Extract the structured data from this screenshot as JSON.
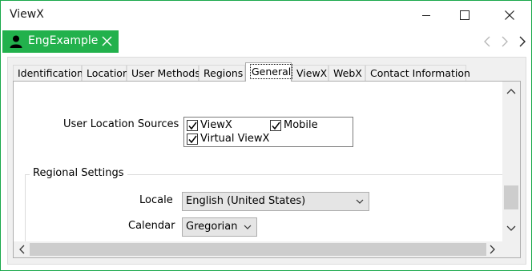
{
  "window": {
    "title": "ViewX"
  },
  "doc_tab": {
    "label": "EngExample"
  },
  "tabs": [
    {
      "label": "Identification"
    },
    {
      "label": "Location"
    },
    {
      "label": "User Methods"
    },
    {
      "label": "Regions"
    },
    {
      "label": "General",
      "active": true
    },
    {
      "label": "ViewX"
    },
    {
      "label": "WebX"
    },
    {
      "label": "Contact Information"
    }
  ],
  "general": {
    "user_location_sources_label": "User Location Sources",
    "sources": [
      {
        "label": "ViewX",
        "checked": true
      },
      {
        "label": "Mobile",
        "checked": true
      },
      {
        "label": "Virtual ViewX",
        "checked": true
      }
    ],
    "regional_settings_title": "Regional Settings",
    "locale_label": "Locale",
    "locale_value": "English (United States)",
    "calendar_label": "Calendar",
    "calendar_value": "Gregorian"
  },
  "colors": {
    "accent": "#22b14c",
    "window_border": "#1aa84b"
  },
  "icons": [
    "user-icon",
    "close-icon",
    "minimize-icon",
    "maximize-icon",
    "chevron-left-icon",
    "chevron-right-icon",
    "chevron-down-icon",
    "chevron-up-icon",
    "checkmark-icon"
  ]
}
